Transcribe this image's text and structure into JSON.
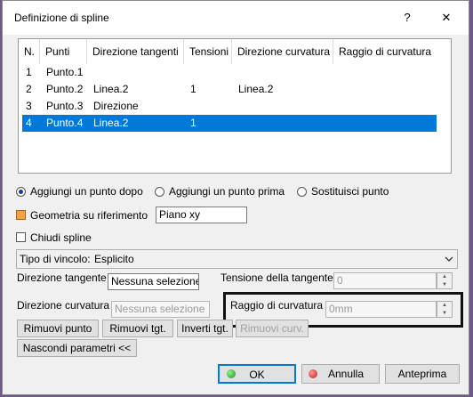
{
  "window": {
    "title": "Definizione di spline",
    "help_glyph": "?",
    "close_glyph": "✕"
  },
  "table": {
    "headers": [
      "N.",
      "Punti",
      "Direzione tangenti",
      "Tensioni",
      "Direzione curvatura",
      "Raggio di curvatura"
    ],
    "rows": [
      {
        "n": "1",
        "punti": "Punto.1",
        "dir_tangenti": "",
        "tensioni": "",
        "dir_curvatura": "",
        "raggio": ""
      },
      {
        "n": "2",
        "punti": "Punto.2",
        "dir_tangenti": "Linea.2",
        "tensioni": "1",
        "dir_curvatura": "Linea.2",
        "raggio": ""
      },
      {
        "n": "3",
        "punti": "Punto.3",
        "dir_tangenti": "Direzione",
        "tensioni": "",
        "dir_curvatura": "",
        "raggio": ""
      },
      {
        "n": "4",
        "punti": "Punto.4",
        "dir_tangenti": "Linea.2",
        "tensioni": "1",
        "dir_curvatura": "",
        "raggio": ""
      }
    ],
    "selected_row": 4
  },
  "options": {
    "radio_after": "Aggiungi un punto dopo",
    "radio_before": "Aggiungi un punto prima",
    "radio_replace": "Sostituisci punto",
    "selected_radio": "Aggiungi un punto dopo",
    "geometry_on_support_label": "Geometria su riferimento",
    "geometry_on_support_checked": true,
    "support_value": "Piano xy",
    "close_spline_label": "Chiudi spline",
    "close_spline_checked": false
  },
  "constraint": {
    "type_label": "Tipo di vincolo:",
    "type_value": "Esplicito",
    "tangent_dir_label": "Direzione tangente",
    "tangent_dir_value": "Nessuna selezione",
    "tangent_tension_label": "Tensione della tangente",
    "tangent_tension_value": "0",
    "curvature_dir_label": "Direzione curvatura",
    "curvature_dir_value": "Nessuna selezione",
    "curvature_radius_label": "Raggio di curvatura",
    "curvature_radius_value": "0mm"
  },
  "buttons": {
    "remove_point": "Rimuovi punto",
    "remove_tgt": "Rimuovi tgt.",
    "invert_tgt": "Inverti tgt.",
    "remove_curv": "Rimuovi curv.",
    "hide_params": "Nascondi parametri <<",
    "ok": "OK",
    "cancel": "Annulla",
    "preview": "Anteprima"
  },
  "colors": {
    "selection": "#0078d7",
    "ok_icon": "#2aa12a",
    "cancel_icon": "#d22",
    "highlight_frame": "#111111"
  }
}
